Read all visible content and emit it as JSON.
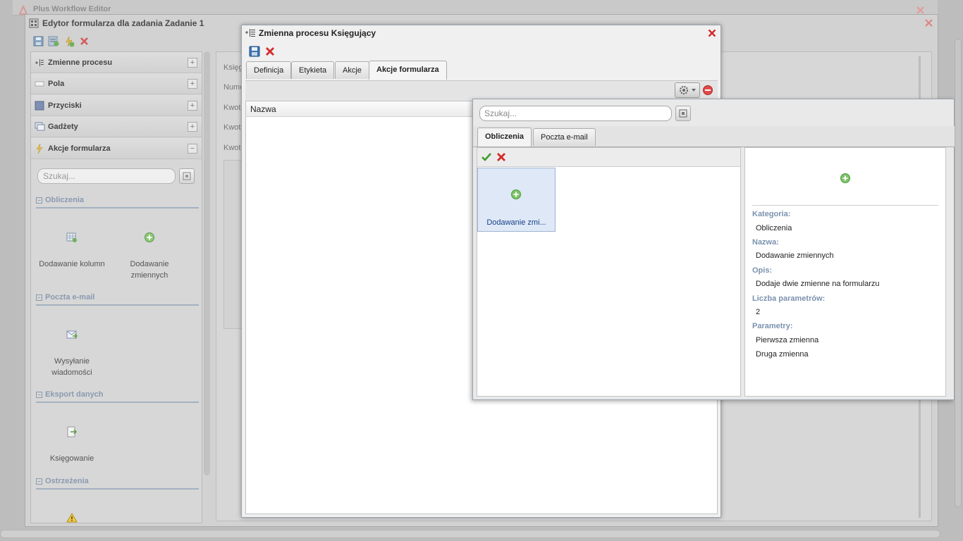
{
  "app": {
    "title": "Plus Workflow Editor"
  },
  "form_editor": {
    "title": "Edytor formularza dla zadania Zadanie 1",
    "accordion": [
      {
        "label": "Zmienne procesu",
        "toggle": "+"
      },
      {
        "label": "Pola",
        "toggle": "+"
      },
      {
        "label": "Przyciski",
        "toggle": "+"
      },
      {
        "label": "Gadżety",
        "toggle": "+"
      },
      {
        "label": "Akcje formularza",
        "toggle": "−"
      }
    ],
    "search_placeholder": "Szukaj...",
    "categories": [
      {
        "title": "Obliczenia",
        "tools": [
          "Dodawanie kolumn",
          "Dodawanie zmiennych"
        ]
      },
      {
        "title": "Poczta e-mail",
        "tools": [
          "Wysyłanie wiadomości"
        ]
      },
      {
        "title": "Eksport danych",
        "tools": [
          "Księgowanie"
        ]
      },
      {
        "title": "Ostrzeżenia",
        "tools": []
      }
    ],
    "center_fragments": [
      "Księg",
      "Nume",
      "Kwot",
      "Kwot",
      "Kwot"
    ]
  },
  "dialog": {
    "title": "Zmienna procesu Księgujący",
    "tabs": [
      "Definicja",
      "Etykieta",
      "Akcje",
      "Akcje formularza"
    ],
    "active_tab": "Akcje formularza",
    "column_header": "Nazwa"
  },
  "picker": {
    "search_placeholder": "Szukaj...",
    "tabs": [
      "Obliczenia",
      "Poczta e-mail"
    ],
    "active_tab": "Obliczenia",
    "tile_label": "Dodawanie zmi...",
    "details": {
      "category_label": "Kategoria:",
      "category_value": "Obliczenia",
      "name_label": "Nazwa:",
      "name_value": "Dodawanie zmiennych",
      "desc_label": "Opis:",
      "desc_value": "Dodaje dwie zmienne na formularzu",
      "count_label": "Liczba parametrów:",
      "count_value": "2",
      "params_label": "Parametry:",
      "params": [
        "Pierwsza zmienna",
        "Druga zmienna"
      ]
    }
  },
  "colors": {
    "accent": "#15428b",
    "close": "#d42a2a",
    "add": "#4caf50",
    "selected_tile": "#dfe8f6"
  }
}
